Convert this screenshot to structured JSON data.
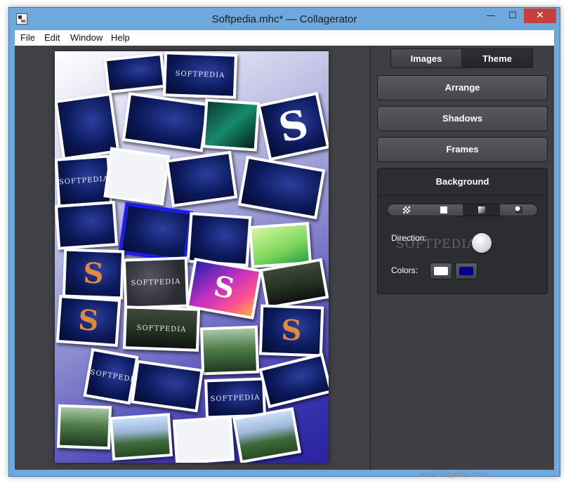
{
  "window": {
    "title": "Softpedia.mhc* — Collagerator",
    "minimize_glyph": "—",
    "maximize_glyph": "☐",
    "close_glyph": "✕"
  },
  "menu": [
    "File",
    "Edit",
    "Window",
    "Help"
  ],
  "collage": {
    "photo_caption": "SOFTPEDIA",
    "logo_letter": "S"
  },
  "sidebar": {
    "tabs": [
      {
        "label": "Images",
        "active": true
      },
      {
        "label": "Theme",
        "active": false
      }
    ],
    "sections": [
      "Arrange",
      "Shadows",
      "Frames"
    ],
    "background": {
      "title": "Background",
      "fill_modes": [
        {
          "icon": "checker-pattern-icon",
          "active": false
        },
        {
          "icon": "solid-fill-icon",
          "active": false
        },
        {
          "icon": "linear-gradient-icon",
          "active": true
        },
        {
          "icon": "radial-gradient-icon",
          "active": false
        }
      ],
      "direction_label": "Direction:",
      "colors_label": "Colors:",
      "colors": [
        "#ffffff",
        "#00008c"
      ]
    }
  },
  "watermark": {
    "panel_text": "SOFTPEDIA",
    "footer_text": "www.softpedia.com"
  }
}
